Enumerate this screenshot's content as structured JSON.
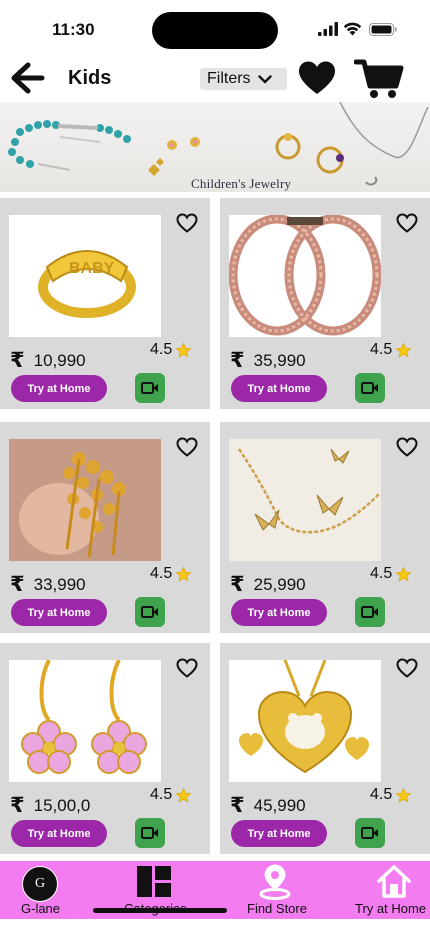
{
  "status_bar": {
    "time": "11:30"
  },
  "header": {
    "title": "Kids",
    "filters_label": "Filters"
  },
  "banner": {
    "caption": "Children's Jewelry"
  },
  "products": [
    {
      "price": "10,990",
      "rating": "4.5",
      "try_label": "Try at Home",
      "image": "gold-baby-ring"
    },
    {
      "price": "35,990",
      "rating": "4.5",
      "try_label": "Try at Home",
      "image": "rose-gold-bangles"
    },
    {
      "price": "33,990",
      "rating": "4.5",
      "try_label": "Try at Home",
      "image": "gold-bead-bangles"
    },
    {
      "price": "25,990",
      "rating": "4.5",
      "try_label": "Try at Home",
      "image": "butterfly-bracelet"
    },
    {
      "price": "15,00,0",
      "rating": "4.5",
      "try_label": "Try at Home",
      "image": "pink-flower-earrings"
    },
    {
      "price": "45,990",
      "rating": "4.5",
      "try_label": "Try at Home",
      "image": "paw-heart-pendant-set"
    }
  ],
  "currency_symbol": "₹",
  "bottom_nav": {
    "logo_text": "G",
    "items": [
      {
        "label": "G-lane"
      },
      {
        "label": "Categories"
      },
      {
        "label": "Find Store"
      },
      {
        "label": "Try at Home"
      }
    ]
  },
  "colors": {
    "try_button": "#9c27a8",
    "video_button": "#3fa34d",
    "bottom_nav": "#f27cf0",
    "card_background": "#d9d9d9"
  }
}
